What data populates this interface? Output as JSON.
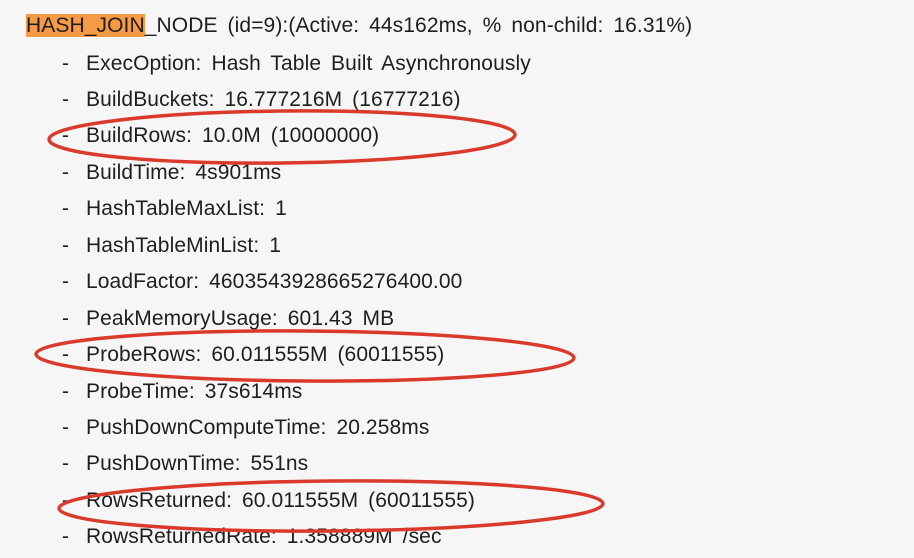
{
  "header": {
    "highlight": "HASH_JOIN",
    "rest": "_NODE  (id=9):(Active:  44s162ms,  %  non-child:  16.31%)"
  },
  "bullet": "-",
  "rows": [
    {
      "label": "ExecOption:",
      "value": "Hash  Table  Built  Asynchronously",
      "circled": false
    },
    {
      "label": "BuildBuckets:",
      "value": "16.777216M  (16777216)",
      "circled": false
    },
    {
      "label": "BuildRows:",
      "value": "10.0M  (10000000)",
      "circled": true
    },
    {
      "label": "BuildTime:",
      "value": "4s901ms",
      "circled": false
    },
    {
      "label": "HashTableMaxList:",
      "value": "1",
      "circled": false
    },
    {
      "label": "HashTableMinList:",
      "value": "1",
      "circled": false
    },
    {
      "label": "LoadFactor:",
      "value": "4603543928665276400.00",
      "circled": false
    },
    {
      "label": "PeakMemoryUsage:",
      "value": "601.43  MB",
      "circled": false
    },
    {
      "label": "ProbeRows:",
      "value": "60.011555M  (60011555)",
      "circled": true
    },
    {
      "label": "ProbeTime:",
      "value": "37s614ms",
      "circled": false
    },
    {
      "label": "PushDownComputeTime:",
      "value": "20.258ms",
      "circled": false
    },
    {
      "label": "PushDownTime:",
      "value": "551ns",
      "circled": false
    },
    {
      "label": "RowsReturned:",
      "value": "60.011555M  (60011555)",
      "circled": true
    },
    {
      "label": "RowsReturnedRate:",
      "value": "1.358889M  /sec",
      "circled": false
    }
  ],
  "colors": {
    "highlight": "#f79a45",
    "annotation": "#d93a2b",
    "text": "#1e1e1e",
    "background": "#f6f6f6"
  }
}
